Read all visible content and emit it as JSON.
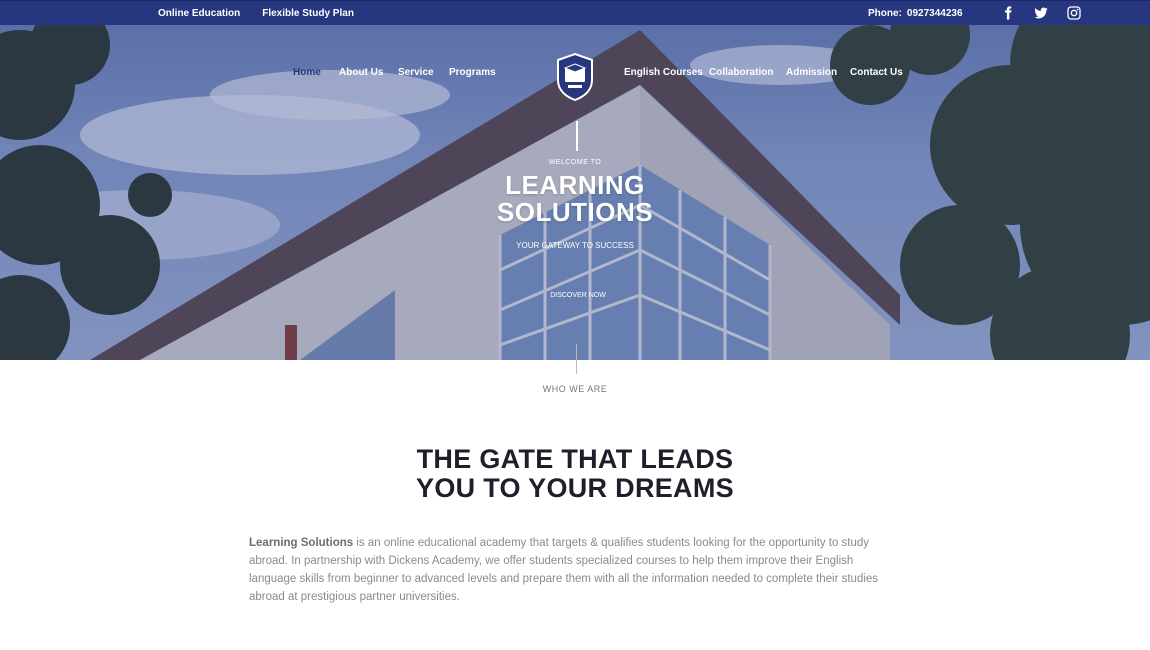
{
  "topbar": {
    "links": [
      "Online Education",
      "Flexible Study Plan"
    ],
    "phone_label": "Phone:",
    "phone_number": "0927344236",
    "social_icons": [
      "facebook-icon",
      "twitter-icon",
      "instagram-icon"
    ]
  },
  "nav": {
    "left": [
      "Home",
      "About Us",
      "Service",
      "Programs"
    ],
    "right": [
      "English Courses",
      "Collaboration",
      "Admission",
      "Contact Us"
    ],
    "active": "Home"
  },
  "hero": {
    "welcome": "WELCOME TO",
    "title_line1": "LEARNING",
    "title_line2": "SOLUTIONS",
    "tagline": "YOUR GATEWAY TO SUCCESS",
    "cta": "DISCOVER NOW"
  },
  "about": {
    "eyebrow": "WHO WE ARE",
    "headline_line1": "THE GATE THAT LEADS",
    "headline_line2": "YOU TO YOUR DREAMS",
    "brand": "Learning Solutions",
    "body": " is an online educational academy that targets & qualifies students looking for the opportunity to study abroad. In partnership with Dickens Academy, we offer students specialized courses to help them improve their English language skills from beginner to advanced levels and prepare them with all the information needed to complete their studies abroad at prestigious partner universities."
  },
  "colors": {
    "brand_navy": "#26367f",
    "headline": "#1f1f2b",
    "body_text": "#8a8a8a"
  }
}
